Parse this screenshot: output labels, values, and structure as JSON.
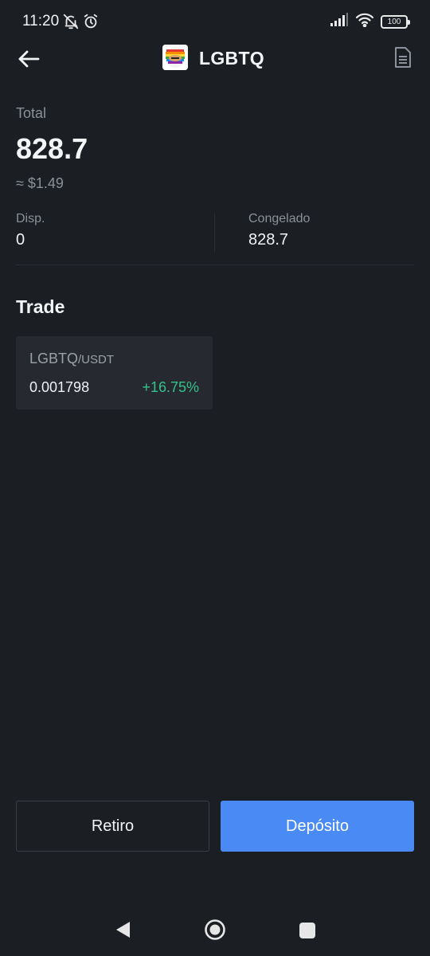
{
  "status_bar": {
    "time": "11:20",
    "battery": "100",
    "icons": [
      "muted-bell-icon",
      "alarm-clock-icon",
      "signal-icon",
      "wifi-icon",
      "battery-icon"
    ]
  },
  "header": {
    "title": "LGBTQ",
    "back_icon": "back-arrow-icon",
    "logo_icon": "token-logo-icon",
    "records_icon": "document-list-icon"
  },
  "balance": {
    "total_label": "Total",
    "total_value": "828.7",
    "usd_value": "≈ $1.49",
    "available_label": "Disp.",
    "available_value": "0",
    "frozen_label": "Congelado",
    "frozen_value": "828.7"
  },
  "trade": {
    "title": "Trade",
    "pairs": [
      {
        "base": "LGBTQ",
        "quote": "/USDT",
        "price": "0.001798",
        "change": "+16.75%"
      }
    ]
  },
  "actions": {
    "withdraw_label": "Retiro",
    "deposit_label": "Depósito"
  },
  "colors": {
    "background": "#1b1e22",
    "card": "#262a30",
    "accent": "#4a8af4",
    "positive": "#35c28a",
    "muted_text": "#8b919a"
  },
  "nav_bar": {
    "icons": [
      "nav-back-icon",
      "nav-home-icon",
      "nav-recents-icon"
    ]
  }
}
